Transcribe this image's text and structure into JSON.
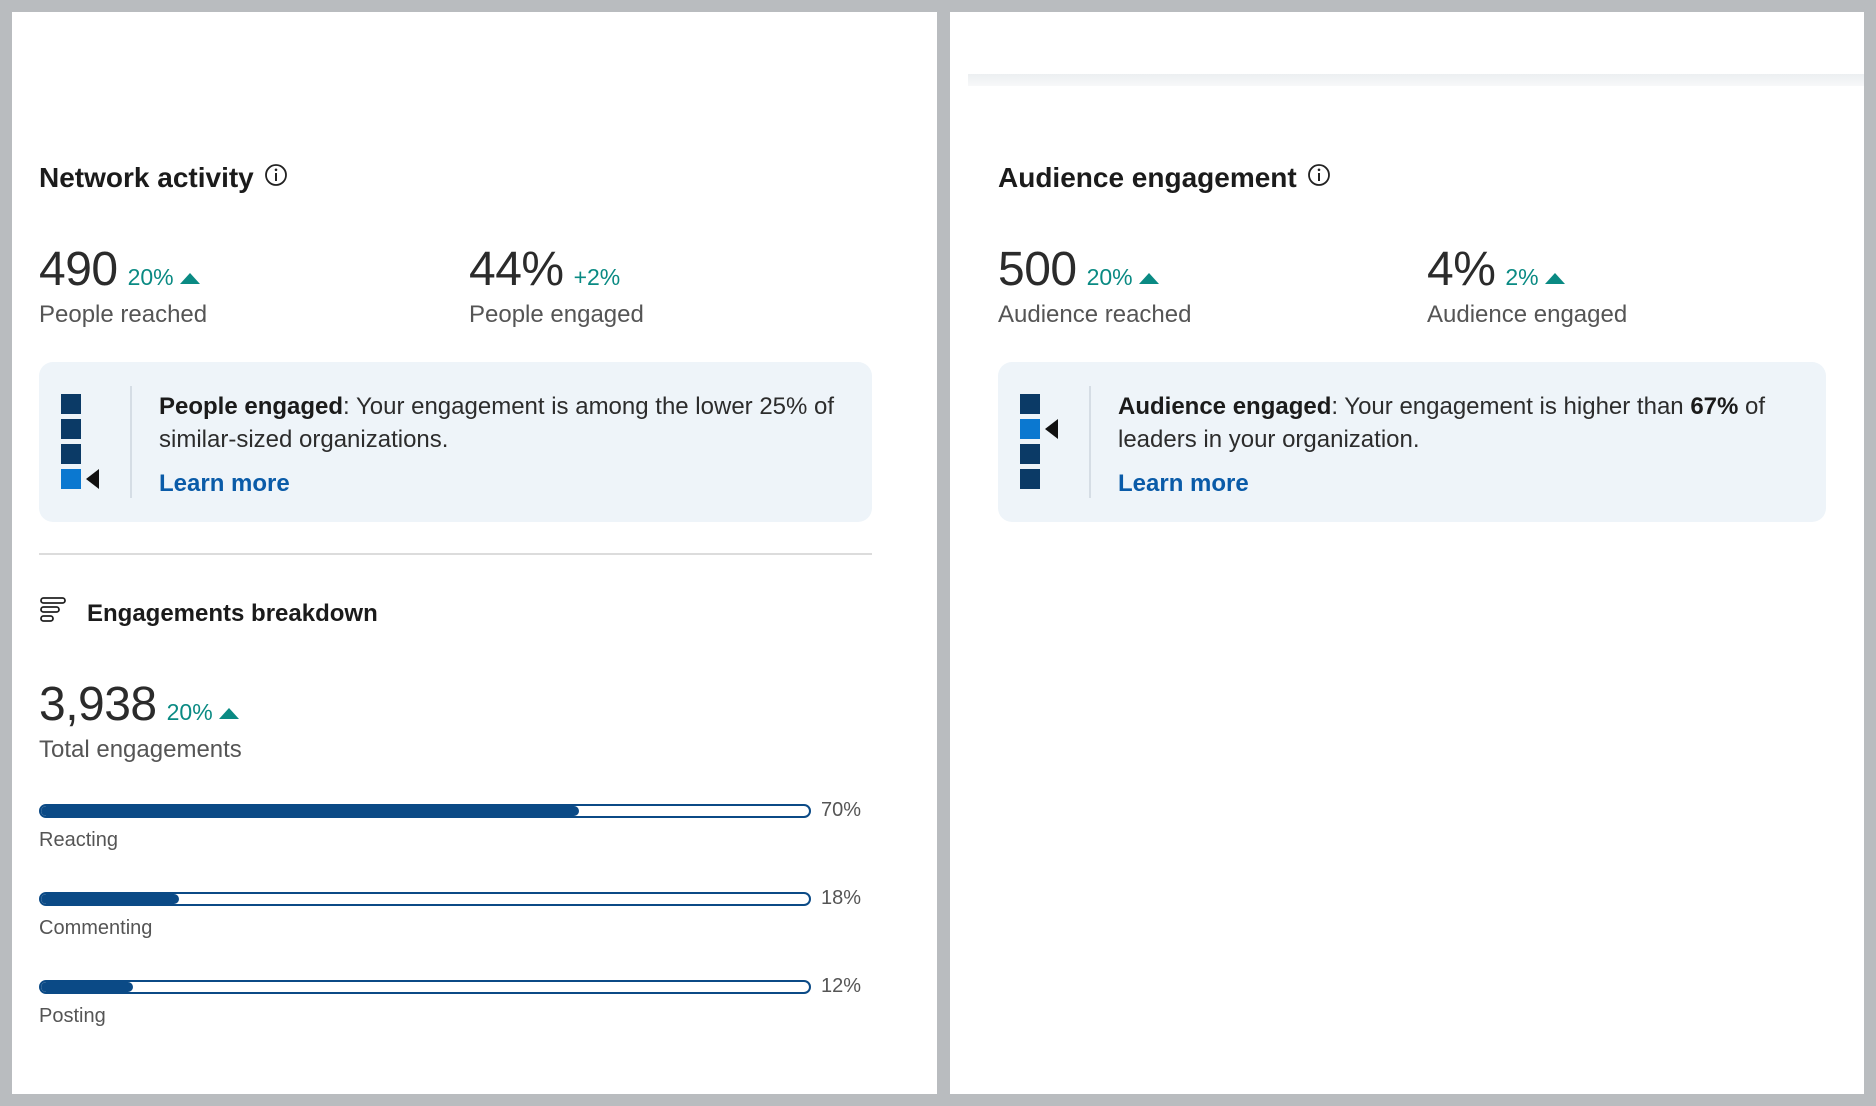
{
  "network_activity": {
    "title": "Network activity",
    "reached": {
      "value": "490",
      "delta": "20%",
      "label": "People reached"
    },
    "engaged": {
      "value": "44%",
      "delta": "+2%",
      "label": "People engaged"
    },
    "callout": {
      "bold": "People engaged",
      "text": ": Your engagement is among the lower 25% of similar-sized organizations.",
      "link": "Learn more"
    }
  },
  "engagements_breakdown": {
    "title": "Engagements breakdown",
    "total": {
      "value": "3,938",
      "delta": "20%",
      "label": "Total engagements"
    },
    "bars": [
      {
        "label": "Reacting",
        "percent": 70,
        "percent_text": "70%"
      },
      {
        "label": "Commenting",
        "percent": 18,
        "percent_text": "18%"
      },
      {
        "label": "Posting",
        "percent": 12,
        "percent_text": "12%"
      }
    ]
  },
  "audience_engagement": {
    "title": "Audience engagement",
    "reached": {
      "value": "500",
      "delta": "20%",
      "label": "Audience reached"
    },
    "engaged": {
      "value": "4%",
      "delta": "2%",
      "label": "Audience engaged"
    },
    "callout": {
      "bold": "Audience engaged",
      "text_before": ": Your engagement is higher than ",
      "bold2": "67%",
      "text_after": " of leaders in your organization.",
      "link": "Learn more"
    }
  },
  "colors": {
    "accent_teal": "#0a8a83",
    "bar_blue": "#0b4a86",
    "link_blue": "#0a5ba8",
    "callout_bg": "#eef4f9",
    "icon_dark": "#0b3a66",
    "icon_highlight": "#0b78d0"
  }
}
